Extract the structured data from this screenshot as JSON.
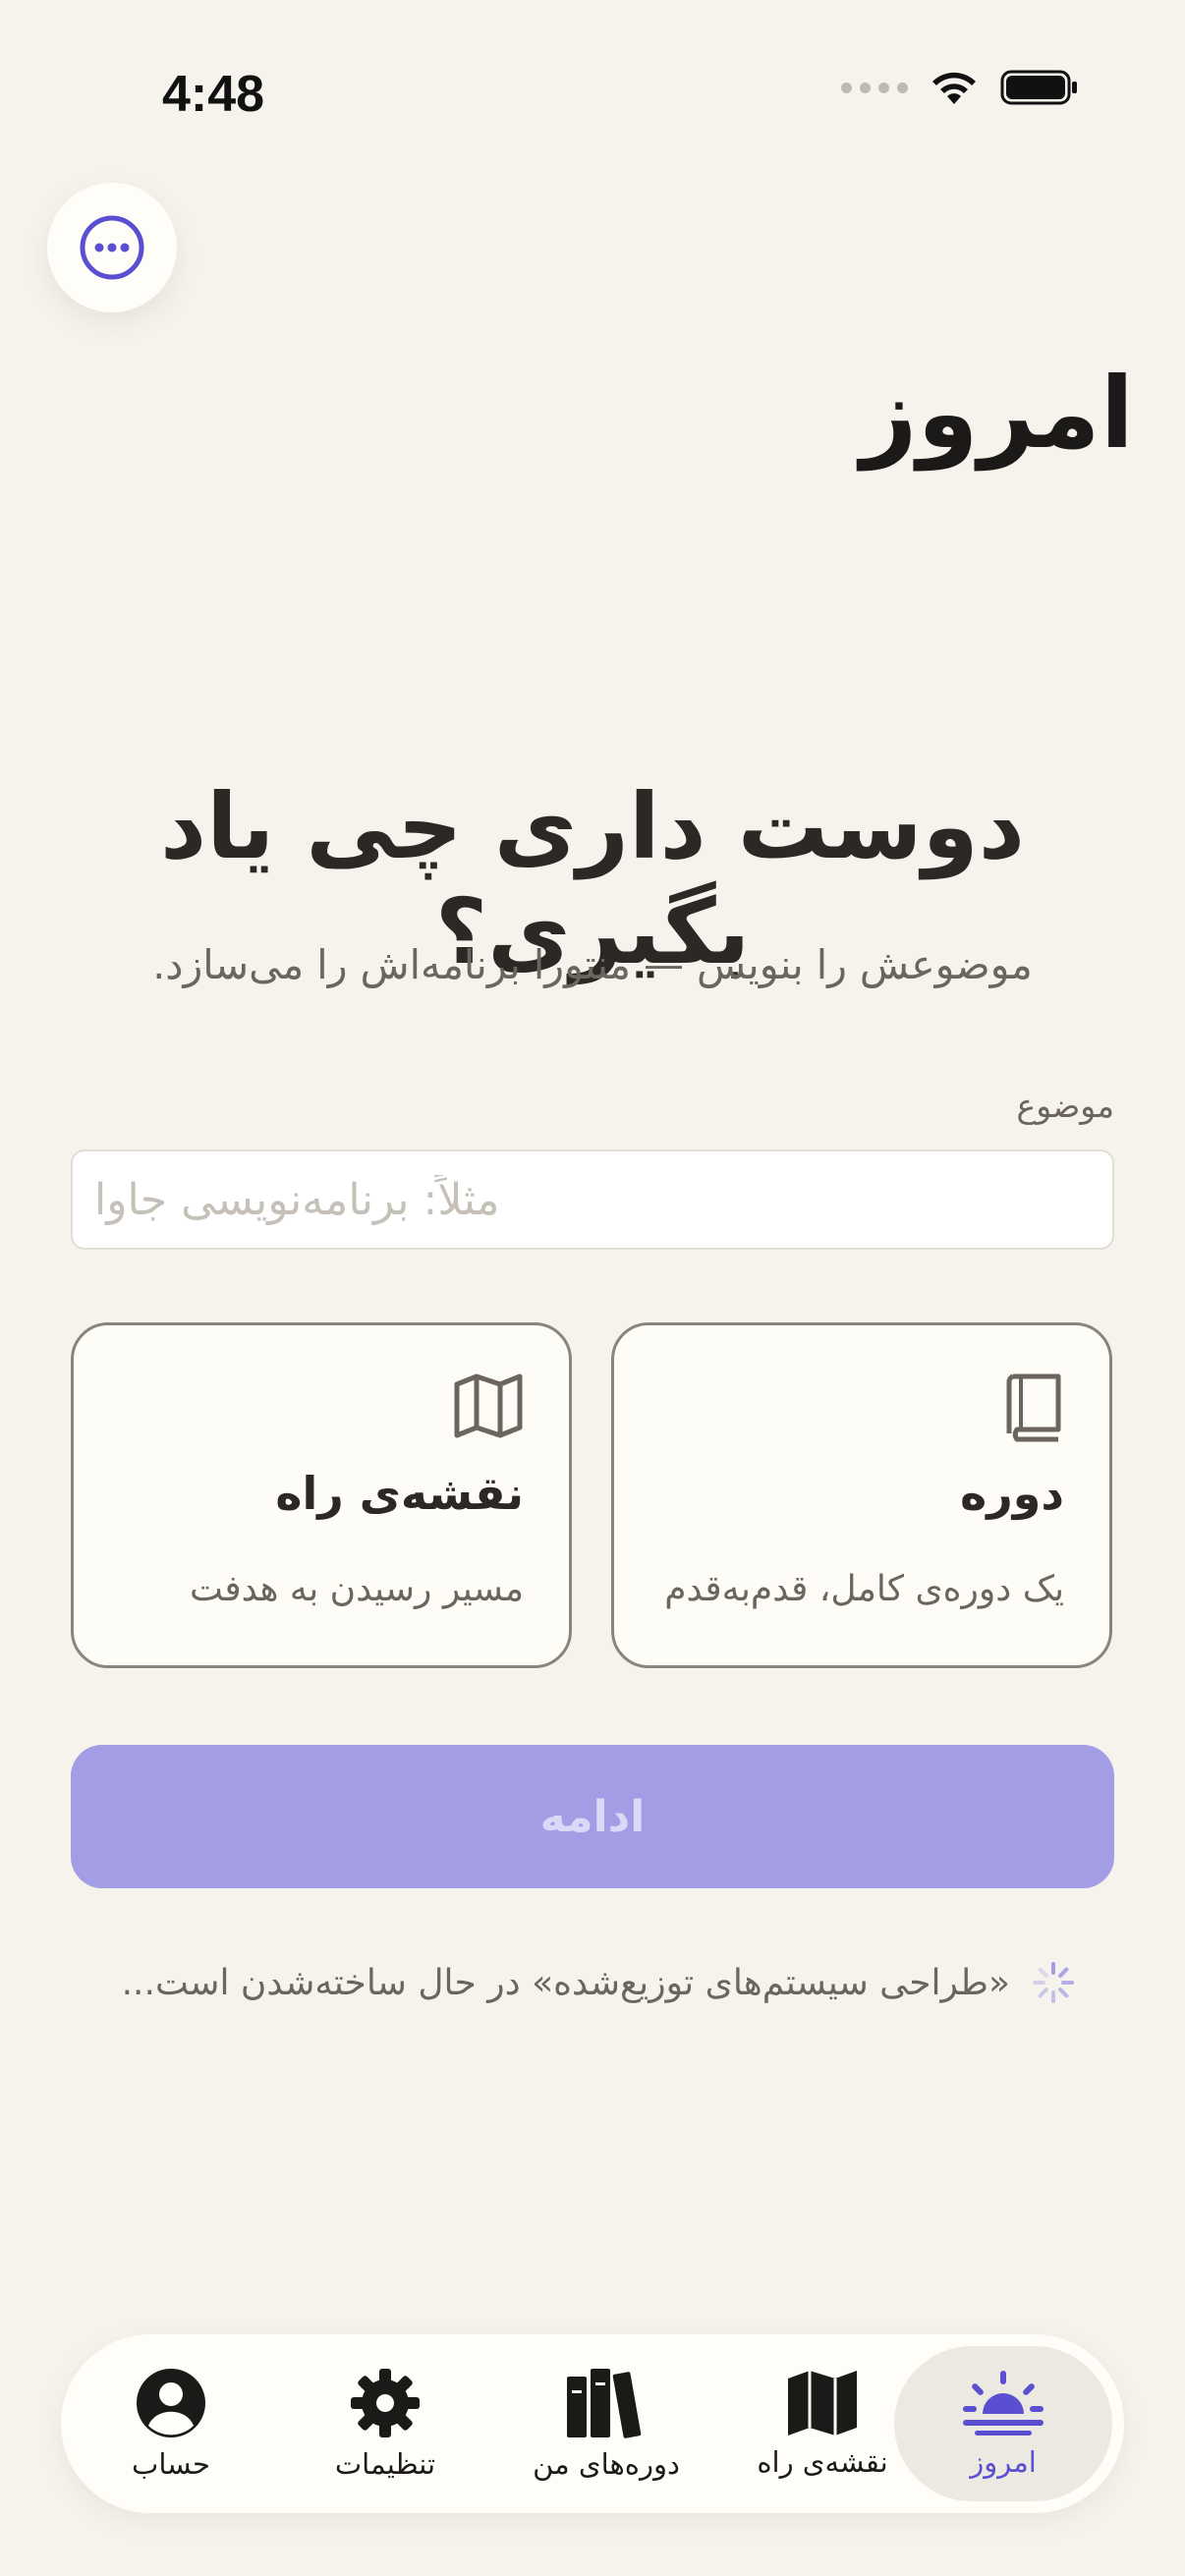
{
  "status_bar": {
    "time": "4:48"
  },
  "header": {
    "more_icon": "ellipsis-circle-icon",
    "title": "امروز"
  },
  "hero": {
    "title": "دوست داری چی یاد بگیری؟",
    "subtitle": "موضوعش را بنویس — منتورا برنامه‌اش را می‌سازد."
  },
  "topic_field": {
    "label": "موضوع",
    "value": "",
    "placeholder": "مثلاً: برنامه‌نویسی جاوا"
  },
  "options": [
    {
      "id": "roadmap",
      "icon": "map-icon",
      "title": "نقشه‌ی راه",
      "description": "مسیر رسیدن به هدفت"
    },
    {
      "id": "course",
      "icon": "book-icon",
      "title": "دوره",
      "description": "یک دوره‌ی کامل، قدم‌به‌قدم"
    }
  ],
  "continue_button": {
    "label": "ادامه",
    "color": "#A39DE6"
  },
  "progress": {
    "icon": "spinner-icon",
    "text": "«طراحی سیستم‌های توزیع‌شده» در حال ساخته‌شدن است..."
  },
  "tab_bar": {
    "tabs": [
      {
        "id": "account",
        "label": "حساب",
        "icon": "person-circle-icon",
        "active": false
      },
      {
        "id": "settings",
        "label": "تنظیمات",
        "icon": "gear-icon",
        "active": false
      },
      {
        "id": "my-courses",
        "label": "دوره‌های من",
        "icon": "books-icon",
        "active": false
      },
      {
        "id": "roadmap",
        "label": "نقشه‌ی راه",
        "icon": "map-icon",
        "active": false
      },
      {
        "id": "today",
        "label": "امروز",
        "icon": "sunrise-icon",
        "active": true
      }
    ]
  },
  "colors": {
    "accent": "#5A4FD0",
    "background": "#F6F3EC",
    "card_border": "#8A847A"
  }
}
